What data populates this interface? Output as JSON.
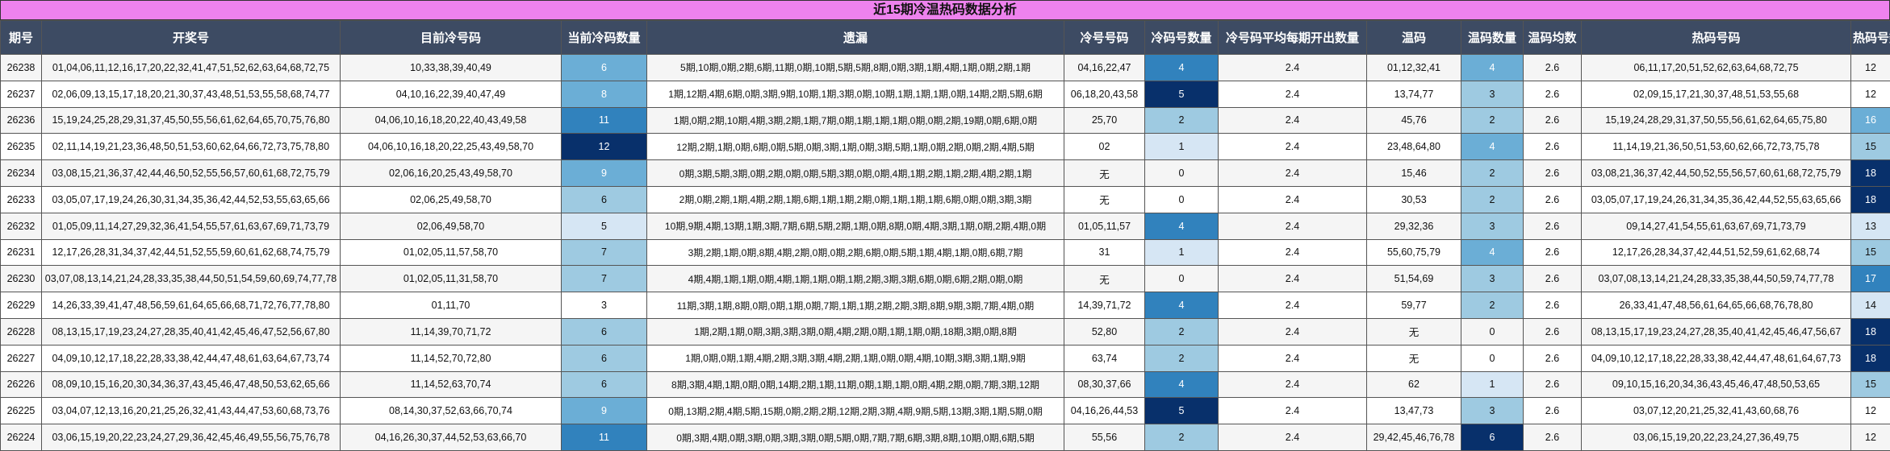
{
  "title": "近15期冷温热码数据分析",
  "headers": [
    "期号",
    "开奖号",
    "目前冷号码",
    "当前冷码数量",
    "遗漏",
    "冷号号码",
    "冷码号数量",
    "冷号码平均每期开出数量",
    "温码",
    "温码数量",
    "温码均数",
    "热码号码",
    "热码号数量"
  ],
  "rows": [
    [
      "26238",
      "01,04,06,11,12,16,17,20,22,32,41,47,51,52,62,63,64,68,72,75",
      "10,33,38,39,40,49",
      "6",
      "5期,10期,0期,2期,6期,11期,0期,10期,5期,5期,8期,0期,3期,1期,4期,1期,0期,2期,1期",
      "04,16,22,47",
      "4",
      "2.4",
      "01,12,32,41",
      "4",
      "2.6",
      "06,11,17,20,51,52,62,63,64,68,72,75",
      "12"
    ],
    [
      "26237",
      "02,06,09,13,15,17,18,20,21,30,37,43,48,51,53,55,58,68,74,77",
      "04,10,16,22,39,40,47,49",
      "8",
      "1期,12期,4期,6期,0期,3期,9期,10期,1期,3期,0期,10期,1期,1期,1期,0期,14期,2期,5期,6期",
      "06,18,20,43,58",
      "5",
      "2.4",
      "13,74,77",
      "3",
      "2.6",
      "02,09,15,17,21,30,37,48,51,53,55,68",
      "12"
    ],
    [
      "26236",
      "15,19,24,25,28,29,31,37,45,50,55,56,61,62,64,65,70,75,76,80",
      "04,06,10,16,18,20,22,40,43,49,58",
      "11",
      "1期,0期,2期,10期,4期,3期,2期,1期,7期,0期,1期,1期,1期,0期,0期,2期,19期,0期,6期,0期",
      "25,70",
      "2",
      "2.4",
      "45,76",
      "2",
      "2.6",
      "15,19,24,28,29,31,37,50,55,56,61,62,64,65,75,80",
      "16"
    ],
    [
      "26235",
      "02,11,14,19,21,23,36,48,50,51,53,60,62,64,66,72,73,75,78,80",
      "04,06,10,16,18,20,22,25,43,49,58,70",
      "12",
      "12期,2期,1期,0期,6期,0期,5期,0期,3期,1期,0期,3期,5期,1期,0期,2期,0期,2期,4期,5期",
      "02",
      "1",
      "2.4",
      "23,48,64,80",
      "4",
      "2.6",
      "11,14,19,21,36,50,51,53,60,62,66,72,73,75,78",
      "15"
    ],
    [
      "26234",
      "03,08,15,21,36,37,42,44,46,50,52,55,56,57,60,61,68,72,75,79",
      "02,06,16,20,25,43,49,58,70",
      "9",
      "0期,3期,5期,3期,0期,2期,0期,0期,5期,3期,0期,0期,4期,1期,2期,1期,2期,4期,2期,1期",
      "无",
      "0",
      "2.4",
      "15,46",
      "2",
      "2.6",
      "03,08,21,36,37,42,44,50,52,55,56,57,60,61,68,72,75,79",
      "18"
    ],
    [
      "26233",
      "03,05,07,17,19,24,26,30,31,34,35,36,42,44,52,53,55,63,65,66",
      "02,06,25,49,58,70",
      "6",
      "2期,0期,2期,1期,4期,2期,1期,6期,1期,1期,2期,0期,1期,1期,1期,6期,0期,0期,3期,3期",
      "无",
      "0",
      "2.4",
      "30,53",
      "2",
      "2.6",
      "03,05,07,17,19,24,26,31,34,35,36,42,44,52,55,63,65,66",
      "18"
    ],
    [
      "26232",
      "01,05,09,11,14,27,29,32,36,41,54,55,57,61,63,67,69,71,73,79",
      "02,06,49,58,70",
      "5",
      "10期,9期,4期,13期,1期,3期,7期,6期,5期,2期,1期,0期,8期,0期,4期,3期,1期,0期,2期,4期,0期",
      "01,05,11,57",
      "4",
      "2.4",
      "29,32,36",
      "3",
      "2.6",
      "09,14,27,41,54,55,61,63,67,69,71,73,79",
      "13"
    ],
    [
      "26231",
      "12,17,26,28,31,34,37,42,44,51,52,55,59,60,61,62,68,74,75,79",
      "01,02,05,11,57,58,70",
      "7",
      "3期,2期,1期,0期,8期,4期,2期,0期,0期,2期,6期,0期,5期,1期,4期,1期,0期,6期,7期",
      "31",
      "1",
      "2.4",
      "55,60,75,79",
      "4",
      "2.6",
      "12,17,26,28,34,37,42,44,51,52,59,61,62,68,74",
      "15"
    ],
    [
      "26230",
      "03,07,08,13,14,21,24,28,33,35,38,44,50,51,54,59,60,69,74,77,78",
      "01,02,05,11,31,58,70",
      "7",
      "4期,4期,1期,1期,0期,4期,1期,1期,0期,1期,2期,3期,3期,6期,0期,6期,2期,0期,0期",
      "无",
      "0",
      "2.4",
      "51,54,69",
      "3",
      "2.6",
      "03,07,08,13,14,21,24,28,33,35,38,44,50,59,74,77,78",
      "17"
    ],
    [
      "26229",
      "14,26,33,39,41,47,48,56,59,61,64,65,66,68,71,72,76,77,78,80",
      "01,11,70",
      "3",
      "11期,3期,1期,8期,0期,0期,1期,0期,7期,1期,1期,2期,2期,3期,8期,9期,3期,7期,4期,0期",
      "14,39,71,72",
      "4",
      "2.4",
      "59,77",
      "2",
      "2.6",
      "26,33,41,47,48,56,61,64,65,66,68,76,78,80",
      "14"
    ],
    [
      "26228",
      "08,13,15,17,19,23,24,27,28,35,40,41,42,45,46,47,52,56,67,80",
      "11,14,39,70,71,72",
      "6",
      "1期,2期,1期,0期,3期,3期,3期,0期,4期,2期,0期,1期,1期,0期,18期,3期,0期,8期",
      "52,80",
      "2",
      "2.4",
      "无",
      "0",
      "2.6",
      "08,13,15,17,19,23,24,27,28,35,40,41,42,45,46,47,56,67",
      "18"
    ],
    [
      "26227",
      "04,09,10,12,17,18,22,28,33,38,42,44,47,48,61,63,64,67,73,74",
      "11,14,52,70,72,80",
      "6",
      "1期,0期,0期,1期,4期,2期,3期,3期,4期,2期,1期,0期,0期,4期,10期,3期,3期,1期,9期",
      "63,74",
      "2",
      "2.4",
      "无",
      "0",
      "2.6",
      "04,09,10,12,17,18,22,28,33,38,42,44,47,48,61,64,67,73",
      "18"
    ],
    [
      "26226",
      "08,09,10,15,16,20,30,34,36,37,43,45,46,47,48,50,53,62,65,66",
      "11,14,52,63,70,74",
      "6",
      "8期,3期,4期,1期,0期,0期,14期,2期,1期,11期,0期,1期,1期,0期,4期,2期,0期,7期,3期,12期",
      "08,30,37,66",
      "4",
      "2.4",
      "62",
      "1",
      "2.6",
      "09,10,15,16,20,34,36,43,45,46,47,48,50,53,65",
      "15"
    ],
    [
      "26225",
      "03,04,07,12,13,16,20,21,25,26,32,41,43,44,47,53,60,68,73,76",
      "08,14,30,37,52,63,66,70,74",
      "9",
      "0期,13期,2期,4期,5期,15期,0期,2期,2期,12期,2期,3期,4期,9期,5期,13期,3期,1期,5期,0期",
      "04,16,26,44,53",
      "5",
      "2.4",
      "13,47,73",
      "3",
      "2.6",
      "03,07,12,20,21,25,32,41,43,60,68,76",
      "12"
    ],
    [
      "26224",
      "03,06,15,19,20,22,23,24,27,29,36,42,45,46,49,55,56,75,76,78",
      "04,16,26,30,37,44,52,53,63,66,70",
      "11",
      "0期,3期,4期,0期,3期,0期,3期,3期,0期,5期,0期,7期,7期,6期,3期,8期,10期,0期,6期,5期",
      "55,56",
      "2",
      "2.4",
      "29,42,45,46,76,78",
      "6",
      "2.6",
      "03,06,15,19,20,22,23,24,27,36,49,75",
      "12"
    ]
  ],
  "shading": {
    "cold_count": [
      "l3",
      "l3",
      "l4",
      "l5",
      "l3",
      "l2",
      "l1",
      "l2",
      "l2",
      "plain",
      "l2",
      "l2",
      "l2",
      "l3",
      "l4"
    ],
    "cold_num_count": [
      "l4",
      "l5",
      "l2",
      "l1",
      "plain",
      "plain",
      "l4",
      "l1",
      "plain",
      "l4",
      "l2",
      "l2",
      "l4",
      "l5",
      "l2"
    ],
    "warm_count": [
      "l3",
      "l2",
      "l2",
      "l3",
      "l2",
      "l2",
      "l2",
      "l3",
      "l2",
      "l2",
      "plain",
      "plain",
      "l1",
      "l2",
      "l5"
    ],
    "hot_count": [
      "plain",
      "plain",
      "l3",
      "l2",
      "l5",
      "l5",
      "l1",
      "l2",
      "l4",
      "l1",
      "l5",
      "l5",
      "l2",
      "plain",
      "plain"
    ]
  }
}
